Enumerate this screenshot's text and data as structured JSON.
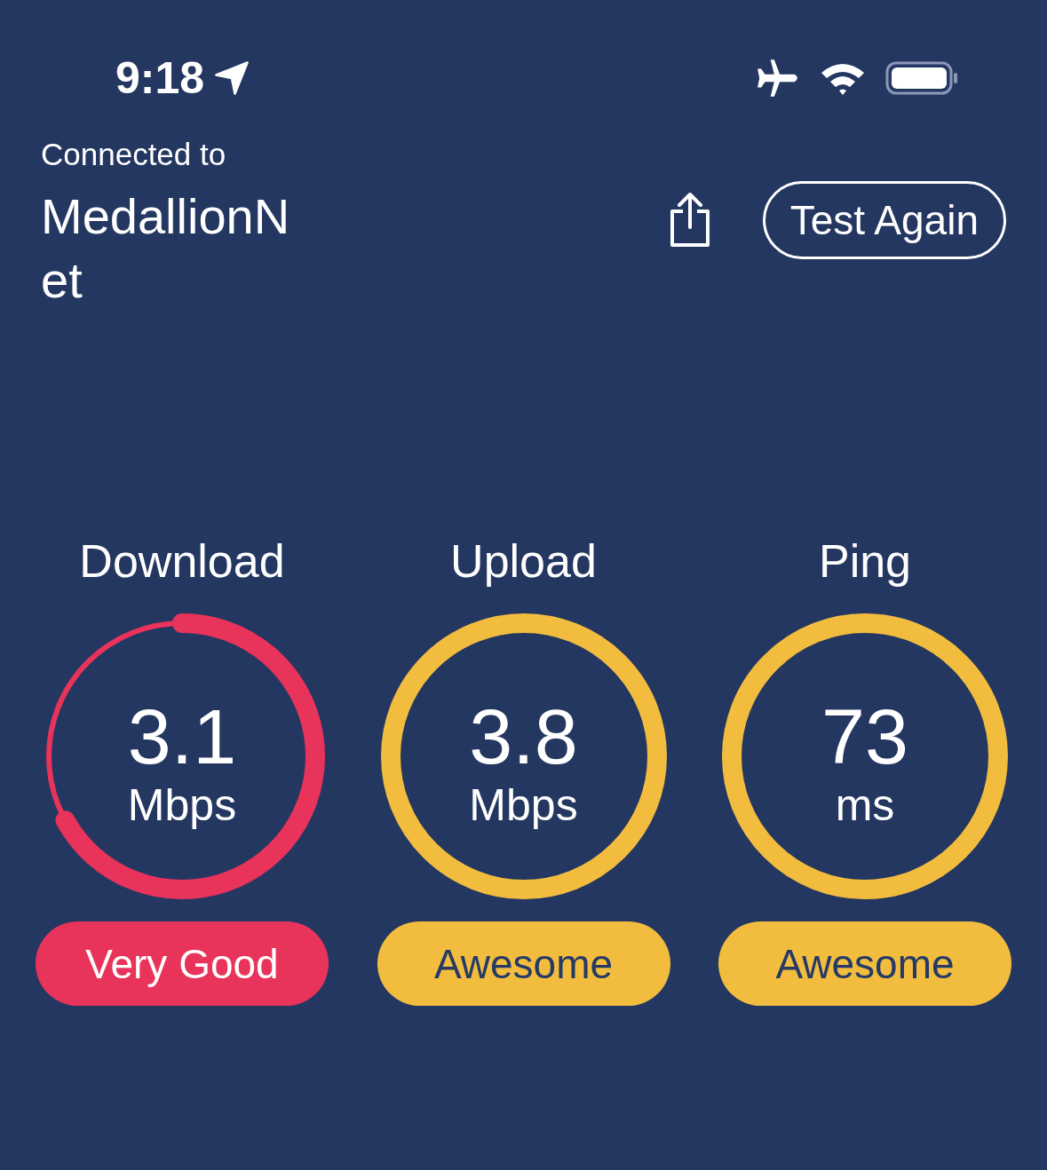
{
  "status_bar": {
    "time": "9:18"
  },
  "header": {
    "caption": "Connected to",
    "network": "MedallionNet",
    "button": "Test Again"
  },
  "metrics": [
    {
      "label": "Download",
      "value": "3.1",
      "unit": "Mbps",
      "kind": "partial",
      "color": "#e8335a",
      "rating": "Very Good"
    },
    {
      "label": "Upload",
      "value": "3.8",
      "unit": "Mbps",
      "kind": "full",
      "color": "#f2bd3f",
      "rating": "Awesome"
    },
    {
      "label": "Ping",
      "value": "73",
      "unit": "ms",
      "kind": "full",
      "color": "#f2bd3f",
      "rating": "Awesome"
    }
  ]
}
